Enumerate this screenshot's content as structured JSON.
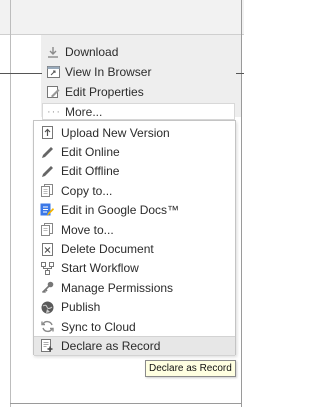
{
  "actions": [
    {
      "label": "Download",
      "icon": "download-icon"
    },
    {
      "label": "View In Browser",
      "icon": "view-in-browser-icon"
    },
    {
      "label": "Edit Properties",
      "icon": "edit-properties-icon"
    }
  ],
  "more_label": "More...",
  "more_menu": [
    {
      "label": "Upload New Version",
      "icon": "upload-icon"
    },
    {
      "label": "Edit Online",
      "icon": "pencil-icon"
    },
    {
      "label": "Edit Offline",
      "icon": "pencil-icon"
    },
    {
      "label": "Copy to...",
      "icon": "copy-icon"
    },
    {
      "label": "Edit in Google Docs™",
      "icon": "google-docs-icon"
    },
    {
      "label": "Move to...",
      "icon": "move-icon"
    },
    {
      "label": "Delete Document",
      "icon": "delete-icon"
    },
    {
      "label": "Start Workflow",
      "icon": "workflow-icon"
    },
    {
      "label": "Manage Permissions",
      "icon": "key-icon"
    },
    {
      "label": "Publish",
      "icon": "publish-icon"
    },
    {
      "label": "Sync to Cloud",
      "icon": "sync-icon"
    },
    {
      "label": "Declare as Record",
      "icon": "declare-record-icon"
    }
  ],
  "tooltip": "Declare as Record",
  "colors": {
    "panel_bg": "#eeeeee",
    "menu_hover": "#e7e7e7",
    "tooltip_bg": "#ffffe1",
    "google_docs_blue": "#3b78e7"
  }
}
